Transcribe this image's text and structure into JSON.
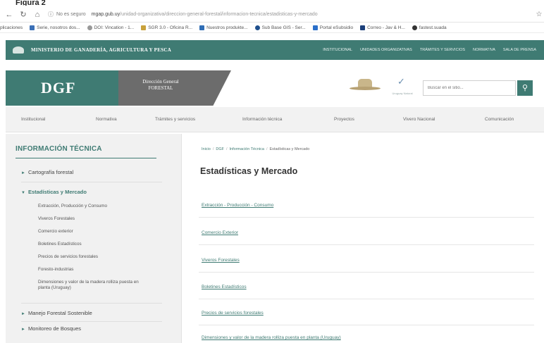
{
  "figure_caption": "Figura 2",
  "browser": {
    "url_status": "No es seguro",
    "url_domain": "mgap.gub.uy",
    "url_path": "/unidad-organizativa/direccion-general-forestal/informacion-tecnica/estadisticas-y-mercado",
    "bookmarks": [
      "plicaciones",
      "Serie, nosotros dos...",
      "DOI: Vincation - 1...",
      "SGR 3.0 - Oficina R...",
      "Nuestros produkte...",
      "Sub Base GIS - Ser...",
      "Portal eSubsidio",
      "Correo - Jav & H...",
      "fastest.suada"
    ]
  },
  "ministry": {
    "name": "MINISTERIO DE GANADERÍA, AGRICULTURA Y PESCA",
    "top_links": [
      "INSTITUCIONAL",
      "UNIDADES ORGANIZATIVAS",
      "TRÁMITES Y SERVICIOS",
      "NORMATIVA",
      "SALA DE PRENSA"
    ]
  },
  "header": {
    "acronym": "DGF",
    "direction_name": "Dirección General FORESTAL",
    "ruv_text": "Uruguay Natural",
    "search_placeholder": "Buscar en el sitio..."
  },
  "nav": [
    "Institucional",
    "Normativa",
    "Trámites y servicios",
    "Información técnica",
    "Proyectos",
    "Vivero Nacional",
    "Comunicación"
  ],
  "sidebar": {
    "title": "INFORMACIÓN TÉCNICA",
    "items": [
      {
        "label": "Cartografía forestal"
      },
      {
        "label": "Estadísticas y Mercado"
      },
      {
        "label": "Manejo Forestal Sostenible"
      },
      {
        "label": "Monitoreo de Bosques"
      }
    ],
    "subitems": [
      "Extracción, Producción y Consumo",
      "Viveros Forestales",
      "Comercio exterior",
      "Boletines Estadísticos",
      "Precios de servicios forestales",
      "Foresto-industrias",
      "Dimensiones y valor de la madera rolliza puesta en planta (Uruguay)"
    ]
  },
  "content": {
    "breadcrumb": [
      "Inicio",
      "DGF",
      "Información Técnica",
      "Estadísticas y Mercado"
    ],
    "title": "Estadísticas y Mercado",
    "links": [
      "Extracción - Producción - Consumo",
      "Comercio Exterior",
      "Viveros Forestales",
      "Boletines Estadísticos",
      "Precios de servicios forestales",
      "Dimensiones y valor de la madera rolliza puesta en planta (Uruguay)"
    ]
  },
  "colors": {
    "brand_green": "#3f7b73",
    "brand_gray": "#6c6c6c"
  }
}
